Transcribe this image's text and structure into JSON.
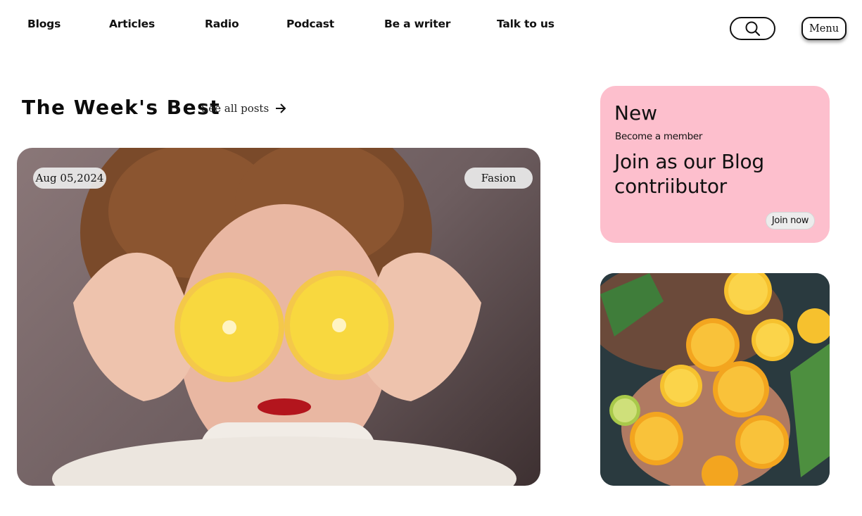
{
  "nav": {
    "items": [
      {
        "label": "Blogs"
      },
      {
        "label": "Articles"
      },
      {
        "label": "Radio"
      },
      {
        "label": "Podcast"
      },
      {
        "label": "Be a writer"
      },
      {
        "label": "Talk to us"
      }
    ],
    "search_icon": "search-icon",
    "menu_label": "Menu"
  },
  "section": {
    "title": "The Week's Best",
    "see_all_label": "See all posts",
    "see_all_icon": "arrow-right-icon"
  },
  "featured": {
    "date": "Aug 05,2024",
    "category": "Fasion"
  },
  "promo": {
    "badge": "New",
    "subtitle": "Become a member",
    "title": "Join as our Blog contriibutor",
    "button_label": "Join now",
    "background_color": "#fdbfcd"
  }
}
